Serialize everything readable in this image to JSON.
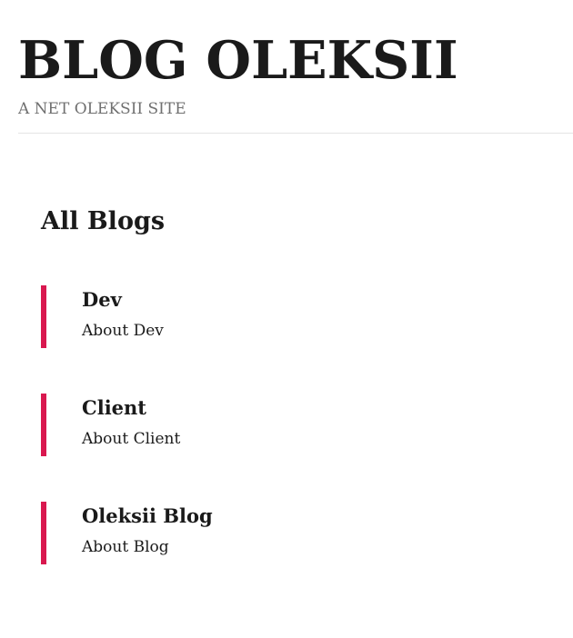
{
  "header": {
    "site_title": "BLOG OLEKSII",
    "site_description": "A NET OLEKSII SITE"
  },
  "main": {
    "heading": "All Blogs",
    "blogs": [
      {
        "title": "Dev",
        "description": "About Dev"
      },
      {
        "title": "Client",
        "description": "About Client"
      },
      {
        "title": "Oleksii Blog",
        "description": "About Blog"
      }
    ]
  },
  "colors": {
    "accent": "#d9184f",
    "text": "#1a1a1a",
    "muted": "#707070",
    "rule": "#e5e5e5"
  }
}
